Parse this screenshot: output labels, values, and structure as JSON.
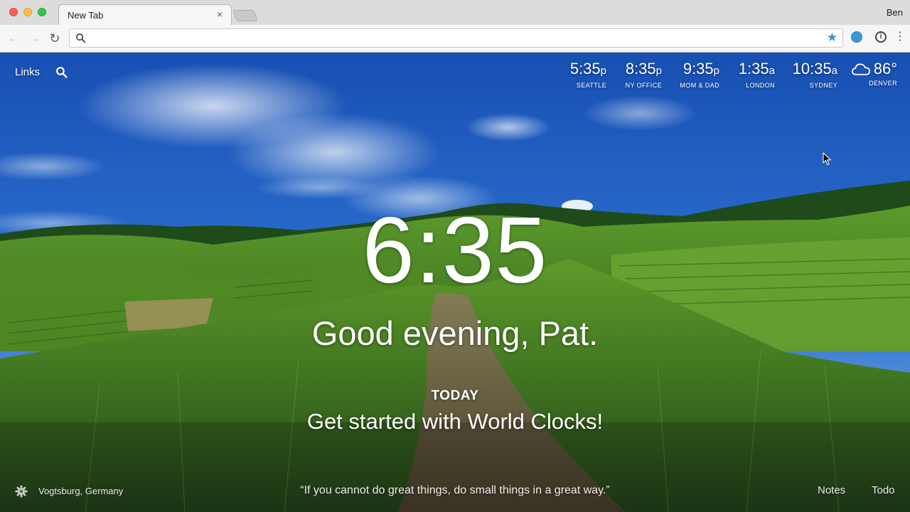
{
  "browser": {
    "tab_title": "New Tab",
    "tab_close": "×",
    "profile_name": "Ben",
    "address_value": "",
    "back_glyph": "←",
    "forward_glyph": "→",
    "reload_glyph": "↻",
    "star_glyph": "★",
    "info_glyph": "i",
    "menu_glyph": "⋮"
  },
  "topbar": {
    "links_label": "Links"
  },
  "clocks": [
    {
      "time": "5:35",
      "suffix": "p",
      "label": "SEATTLE"
    },
    {
      "time": "8:35",
      "suffix": "p",
      "label": "NY OFFICE"
    },
    {
      "time": "9:35",
      "suffix": "p",
      "label": "MOM & DAD"
    },
    {
      "time": "1:35",
      "suffix": "a",
      "label": "LONDON"
    },
    {
      "time": "10:35",
      "suffix": "a",
      "label": "SYDNEY"
    }
  ],
  "weather": {
    "temp": "86°",
    "location": "DENVER",
    "icon": "cloud-icon"
  },
  "center": {
    "time": "6:35",
    "greeting": "Good evening, Pat.",
    "today_label": "TODAY",
    "focus": "Get started with World Clocks!"
  },
  "footer": {
    "location": "Vogtsburg, Germany",
    "quote": "“If you cannot do great things, do small things in a great way.”",
    "notes_label": "Notes",
    "todo_label": "Todo"
  },
  "colors": {
    "star": "#3a8dde",
    "extension": "#3a9ad9"
  }
}
